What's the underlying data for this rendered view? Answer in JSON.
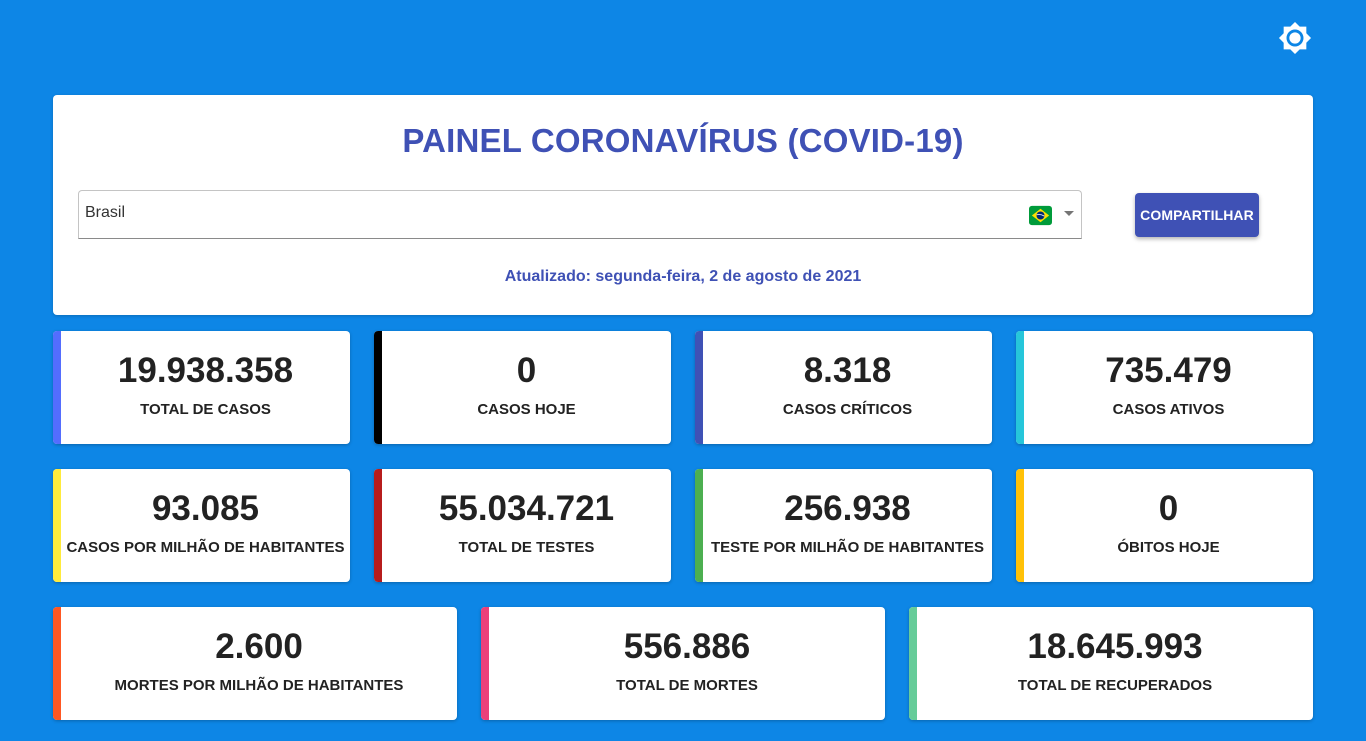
{
  "title": "PAINEL CORONAVÍRUS (COVID-19)",
  "country": {
    "value": "Brasil",
    "flag": "brazil-flag"
  },
  "share_label": "COMPARTILHAR",
  "updated": "Atualizado: segunda-feira, 2 de agosto de 2021",
  "stats": [
    {
      "value": "19.938.358",
      "label": "TOTAL DE CASOS",
      "color": "#536dfe"
    },
    {
      "value": "0",
      "label": "CASOS HOJE",
      "color": "#000000"
    },
    {
      "value": "8.318",
      "label": "CASOS CRÍTICOS",
      "color": "#3f51b5"
    },
    {
      "value": "735.479",
      "label": "CASOS ATIVOS",
      "color": "#26c6da"
    },
    {
      "value": "93.085",
      "label": "CASOS POR MILHÃO DE HABITANTES",
      "color": "#ffeb3b"
    },
    {
      "value": "55.034.721",
      "label": "TOTAL DE TESTES",
      "color": "#b71c1c"
    },
    {
      "value": "256.938",
      "label": "TESTE POR MILHÃO DE HABITANTES",
      "color": "#4caf50"
    },
    {
      "value": "0",
      "label": "ÓBITOS HOJE",
      "color": "#ffc107"
    },
    {
      "value": "2.600",
      "label": "MORTES POR MILHÃO DE HABITANTES",
      "color": "#ff5722"
    },
    {
      "value": "556.886",
      "label": "TOTAL DE MORTES",
      "color": "#ec407a"
    },
    {
      "value": "18.645.993",
      "label": "TOTAL DE RECUPERADOS",
      "color": "#66cc99"
    }
  ]
}
